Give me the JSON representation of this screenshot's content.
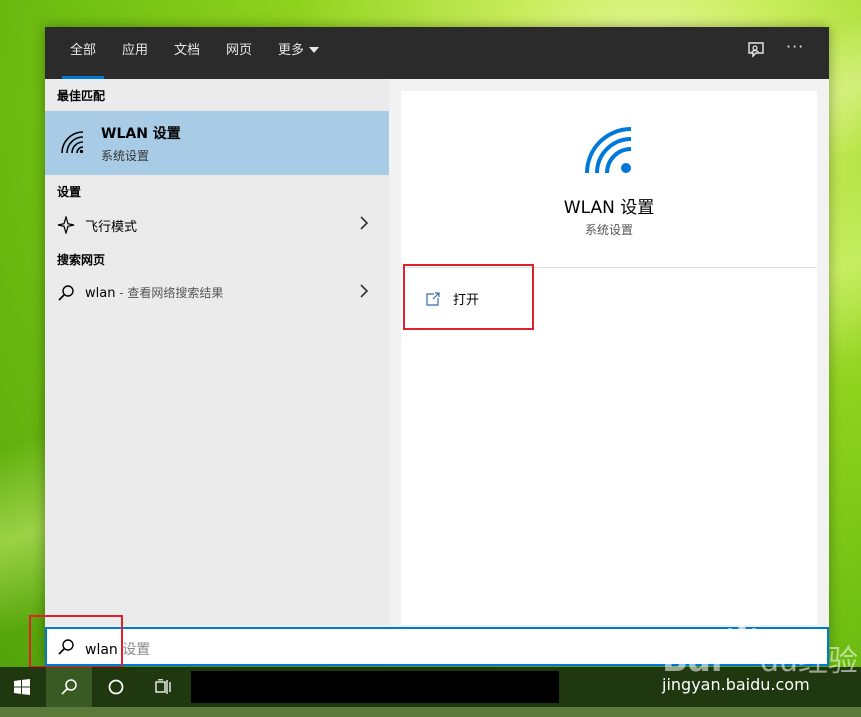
{
  "tabs": [
    {
      "label": "全部",
      "active": true
    },
    {
      "label": "应用",
      "active": false
    },
    {
      "label": "文档",
      "active": false
    },
    {
      "label": "网页",
      "active": false
    },
    {
      "label": "更多",
      "active": false
    }
  ],
  "topbar_icons": [
    "feedback-icon",
    "more-options-icon"
  ],
  "left_panel": {
    "best_match_heading": "最佳匹配",
    "best_match": {
      "title": "WLAN 设置",
      "subtitle": "系统设置",
      "icon": "wifi-icon"
    },
    "settings_heading": "设置",
    "settings_items": [
      {
        "label": "飞行模式",
        "icon": "airplane-icon"
      }
    ],
    "web_heading": "搜索网页",
    "web_items": [
      {
        "query": "wlan",
        "suffix": " - 查看网络搜索结果",
        "icon": "search-icon"
      }
    ]
  },
  "detail": {
    "title": "WLAN 设置",
    "subtitle": "系统设置",
    "actions": [
      {
        "label": "打开",
        "icon": "open-icon"
      }
    ]
  },
  "search": {
    "typed": "wlan",
    "suggestion": " 设置"
  },
  "taskbar": {
    "buttons": [
      "windows-start-icon",
      "search-icon",
      "cortana-icon",
      "task-view-icon"
    ]
  },
  "watermark": {
    "logo": "Baidu经验",
    "url": "jingyan.baidu.com"
  },
  "colors": {
    "accent": "#0078d7",
    "selection": "#a9cce6",
    "annotation": "#e0202a",
    "topbar": "#2b2b2b"
  }
}
